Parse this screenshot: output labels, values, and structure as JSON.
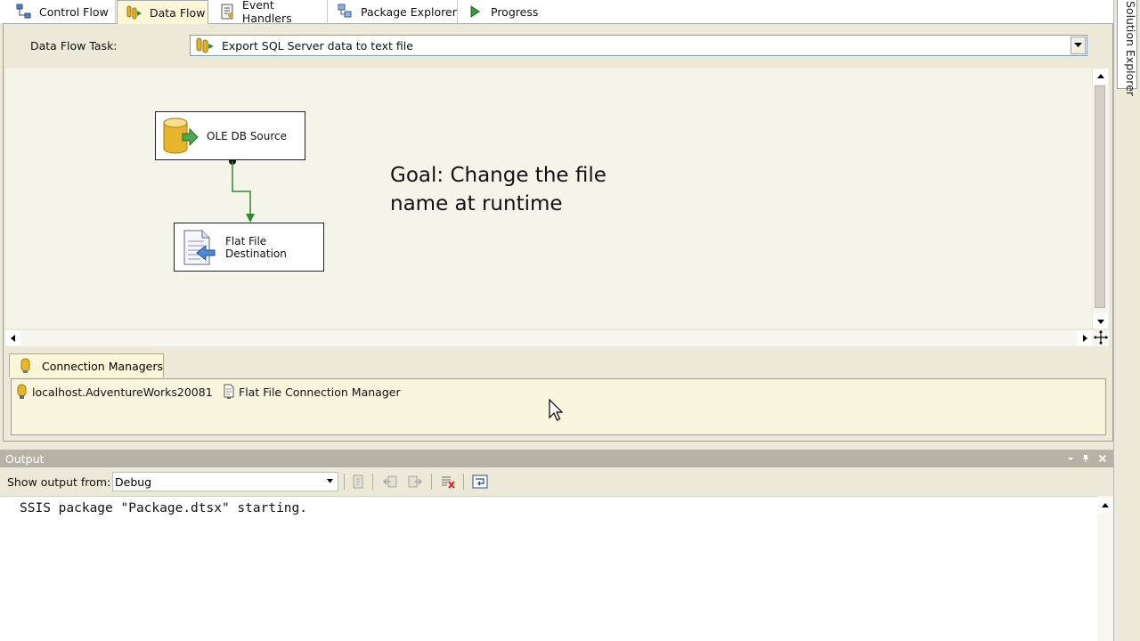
{
  "tabs": [
    {
      "label": "Control Flow",
      "icon": "control-flow-icon"
    },
    {
      "label": "Data Flow",
      "icon": "data-flow-icon",
      "active": true
    },
    {
      "label": "Event Handlers",
      "icon": "event-handlers-icon"
    },
    {
      "label": "Package Explorer",
      "icon": "package-explorer-icon"
    },
    {
      "label": "Progress",
      "icon": "progress-arrow-icon"
    }
  ],
  "task_bar": {
    "label": "Data Flow Task:",
    "selected_task": "Export SQL Server data to text file"
  },
  "canvas": {
    "components": [
      {
        "label": "OLE DB Source",
        "icon": "database-cylinder-icon"
      },
      {
        "label_line1": "Flat File",
        "label_line2": "Destination",
        "icon": "flat-file-icon"
      }
    ],
    "annotation_line1": "Goal: Change the file",
    "annotation_line2": "name at runtime"
  },
  "connection_managers": {
    "tab_label": "Connection Managers",
    "items": [
      {
        "label": "localhost.AdventureWorks20081",
        "icon": "db-connection-icon"
      },
      {
        "label": "Flat File Connection Manager",
        "icon": "file-connection-icon"
      }
    ]
  },
  "right_panel": {
    "label": "Solution Explorer"
  },
  "output": {
    "title": "Output",
    "show_label": "Show output from:",
    "source": "Debug",
    "lines": [
      "SSIS package \"Package.dtsx\" starting."
    ]
  },
  "colors": {
    "canvas_bg": "#f5f4e8",
    "chrome_bg": "#ece9d8",
    "connector_green": "#2f8a2f",
    "output_title_bg": "#b6b3a6"
  }
}
